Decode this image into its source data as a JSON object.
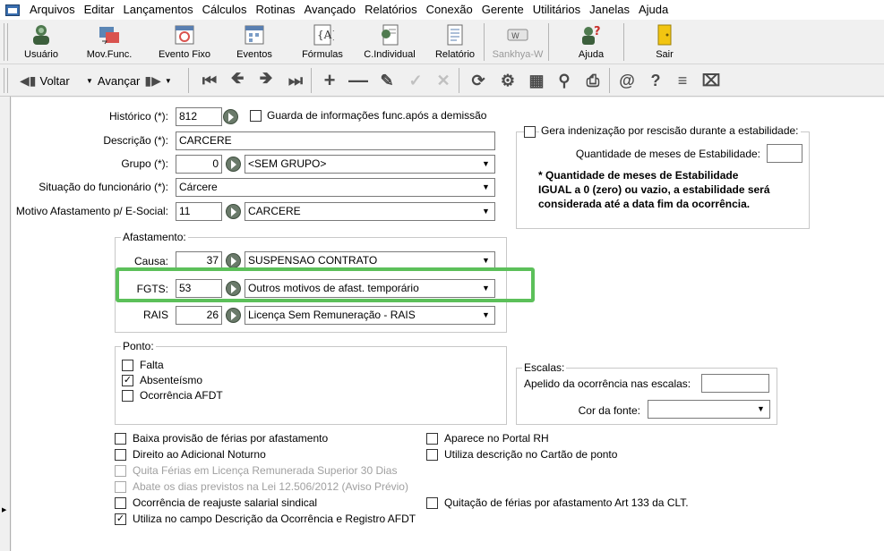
{
  "menu": [
    "Arquivos",
    "Editar",
    "Lançamentos",
    "Cálculos",
    "Rotinas",
    "Avançado",
    "Relatórios",
    "Conexão",
    "Gerente",
    "Utilitários",
    "Janelas",
    "Ajuda"
  ],
  "toolbar1": {
    "usuario": "Usuário",
    "mov_func": "Mov.Func.",
    "evento_fixo": "Evento Fixo",
    "eventos": "Eventos",
    "formulas": "Fórmulas",
    "c_individual": "C.Individual",
    "relatorio": "Relatório",
    "sankhya": "Sankhya-W",
    "ajuda": "Ajuda",
    "sair": "Sair"
  },
  "toolbar2": {
    "voltar": "Voltar",
    "avancar": "Avançar"
  },
  "form": {
    "historico": {
      "label": "Histórico (*):",
      "value": "812"
    },
    "guarda_info": {
      "label": "Guarda de informações func.após a demissão",
      "checked": false
    },
    "descricao": {
      "label": "Descrição (*):",
      "value": "CARCERE"
    },
    "grupo": {
      "label": "Grupo (*):",
      "code": "0",
      "value": "<SEM GRUPO>"
    },
    "situacao": {
      "label": "Situação do funcionário (*):",
      "value": "Cárcere"
    },
    "motivo_esocial": {
      "label": "Motivo Afastamento p/ E-Social:",
      "code": "11",
      "value": "CARCERE"
    },
    "afastamento": {
      "title": "Afastamento:",
      "causa": {
        "label": "Causa:",
        "code": "37",
        "value": "SUSPENSAO CONTRATO"
      },
      "fgts": {
        "label": "FGTS:",
        "code": "53",
        "value": "Outros motivos de afast. temporário"
      },
      "rais": {
        "label": "RAIS",
        "code": "26",
        "value": "Licença Sem Remuneração - RAIS"
      }
    },
    "ponto": {
      "title": "Ponto:",
      "falta": {
        "label": "Falta",
        "checked": false
      },
      "absenteismo": {
        "label": "Absenteísmo",
        "checked": true
      },
      "ocorrencia_afdt": {
        "label": "Ocorrência AFDT",
        "checked": false
      }
    },
    "estabilidade": {
      "gera": {
        "label": "Gera indenização por rescisão durante a estabilidade:",
        "checked": false
      },
      "qtd_label": "Quantidade de meses de Estabilidade:",
      "qtd_value": "",
      "note_line1": "* Quantidade de meses de Estabilidade",
      "note_line2": "IGUAL a 0 (zero) ou vazio, a estabilidade será",
      "note_line3": "considerada até a data fim da ocorrência."
    },
    "escalas": {
      "title": "Escalas:",
      "apelido_label": "Apelido da ocorrência nas escalas:",
      "apelido_value": "",
      "cor_label": "Cor da fonte:",
      "cor_value": ""
    },
    "checks_left": [
      {
        "label": "Baixa provisão de férias por afastamento",
        "checked": false,
        "disabled": false
      },
      {
        "label": "Direito ao Adicional Noturno",
        "checked": false,
        "disabled": false
      },
      {
        "label": "Quita Férias em Licença Remunerada Superior 30 Dias",
        "checked": false,
        "disabled": true
      },
      {
        "label": "Abate os dias previstos na Lei 12.506/2012 (Aviso Prévio)",
        "checked": false,
        "disabled": true
      },
      {
        "label": "Ocorrência de reajuste salarial sindical",
        "checked": false,
        "disabled": false
      },
      {
        "label": "Utiliza no campo Descrição da Ocorrência e Registro AFDT",
        "checked": true,
        "disabled": false
      }
    ],
    "checks_right": [
      {
        "label": "Aparece no Portal RH",
        "checked": false
      },
      {
        "label": "Utiliza descrição no Cartão de ponto",
        "checked": false
      },
      {
        "label": "Quitação de férias por afastamento Art 133 da CLT.",
        "checked": false
      }
    ]
  },
  "colors": {
    "highlight": "#5cc05a"
  }
}
